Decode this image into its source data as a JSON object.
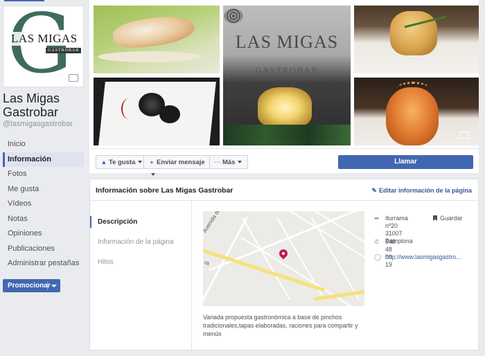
{
  "page": {
    "name": "Las Migas Gastrobar",
    "handle": "@lasmigasgastrobar"
  },
  "logo": {
    "letter": "G",
    "name": "LAS MIGAS",
    "subtitle": "GASTROBAR"
  },
  "cover": {
    "sign_main": "LAS MIGAS",
    "sign_sub": "GASTROBAR"
  },
  "nav": {
    "items": [
      "Inicio",
      "Información",
      "Fotos",
      "Me gusta",
      "Vídeos",
      "Notas",
      "Opiniones",
      "Publicaciones",
      "Administrar pestañas"
    ],
    "active": "Información"
  },
  "promote": {
    "label": "Promocionar"
  },
  "actions": {
    "like": "Te gusta",
    "message": "Enviar mensaje",
    "more": "Más",
    "call": "Llamar"
  },
  "info": {
    "title": "Información sobre Las Migas Gastrobar",
    "edit": "Editar información de la página",
    "tabs": [
      "Descripción",
      "Información de la página",
      "Hitos"
    ],
    "description": "Variada propuesta gastronómica a base de pinchos tradicionales,tapas elaboradas, raciones para compartir y menús",
    "address_line1": "Iturrama nº20",
    "address_line2": "31007 Pamplona",
    "save": "Guardar",
    "phone": "948 48 00 19",
    "website": "http://www.lasmigasgastro...",
    "map_label_1": "Avenida de",
    "map_label_2": "ra"
  },
  "colors": {
    "brand_blue": "#4267b2",
    "link_blue": "#365899",
    "pin": "#c2185b",
    "logo_green": "#3f6b5e"
  }
}
